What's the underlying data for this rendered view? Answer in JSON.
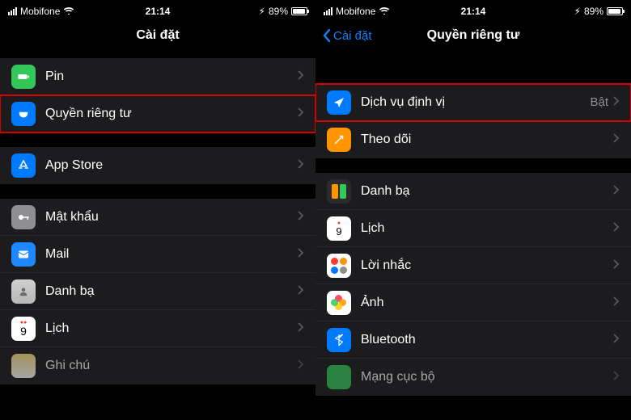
{
  "status": {
    "carrier": "Mobifone",
    "time": "21:14",
    "battery": "89%"
  },
  "left": {
    "title": "Cài đặt",
    "rows": {
      "battery": "Pin",
      "privacy": "Quyền riêng tư",
      "appstore": "App Store",
      "passwords": "Mật khẩu",
      "mail": "Mail",
      "contacts": "Danh bạ",
      "calendar": "Lịch",
      "notes": "Ghi chú"
    }
  },
  "right": {
    "back": "Cài đặt",
    "title": "Quyền riêng tư",
    "rows": {
      "location": "Dịch vụ định vị",
      "location_state": "Bật",
      "tracking": "Theo dõi",
      "contacts": "Danh bạ",
      "calendar": "Lịch",
      "reminders": "Lời nhắc",
      "photos": "Ảnh",
      "bluetooth": "Bluetooth",
      "localnet": "Mạng cục bộ"
    }
  }
}
